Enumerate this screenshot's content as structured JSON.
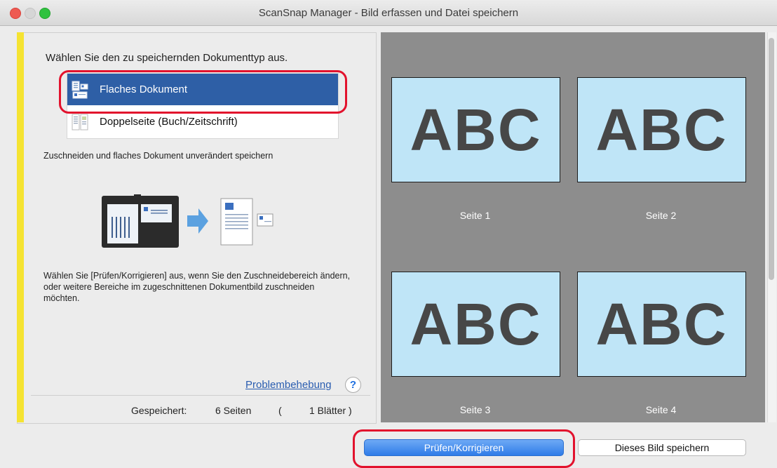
{
  "window": {
    "title": "ScanSnap Manager - Bild erfassen und Datei speichern"
  },
  "left": {
    "prompt": "Wählen Sie den zu speichernden Dokumenttyp aus.",
    "types": [
      {
        "label": "Flaches Dokument",
        "selected": true
      },
      {
        "label": "Doppelseite (Buch/Zeitschrift)",
        "selected": false
      }
    ],
    "description": "Zuschneiden und flaches Dokument unverändert speichern",
    "hint": "Wählen Sie [Prüfen/Korrigieren] aus, wenn Sie den Zuschneidebereich ändern, oder weitere Bereiche im zugeschnittenen Dokumentbild zuschneiden möchten.",
    "help_link": "Problembehebung",
    "help_icon": "?",
    "status": {
      "label": "Gespeichert:",
      "pages": "6 Seiten",
      "open_paren": "(",
      "sheets": "1 Blätter )"
    }
  },
  "preview": {
    "pages": [
      {
        "text": "ABC",
        "label": "Seite 1"
      },
      {
        "text": "ABC",
        "label": "Seite 2"
      },
      {
        "text": "ABC",
        "label": "Seite 3"
      },
      {
        "text": "ABC",
        "label": "Seite 4"
      }
    ]
  },
  "buttons": {
    "review": "Prüfen/Korrigieren",
    "save": "Dieses Bild speichern"
  },
  "colors": {
    "accent": "#2e5fa6",
    "highlight": "#e2122d",
    "yellow": "#f5e332",
    "thumb_bg": "#bfe5f7"
  }
}
